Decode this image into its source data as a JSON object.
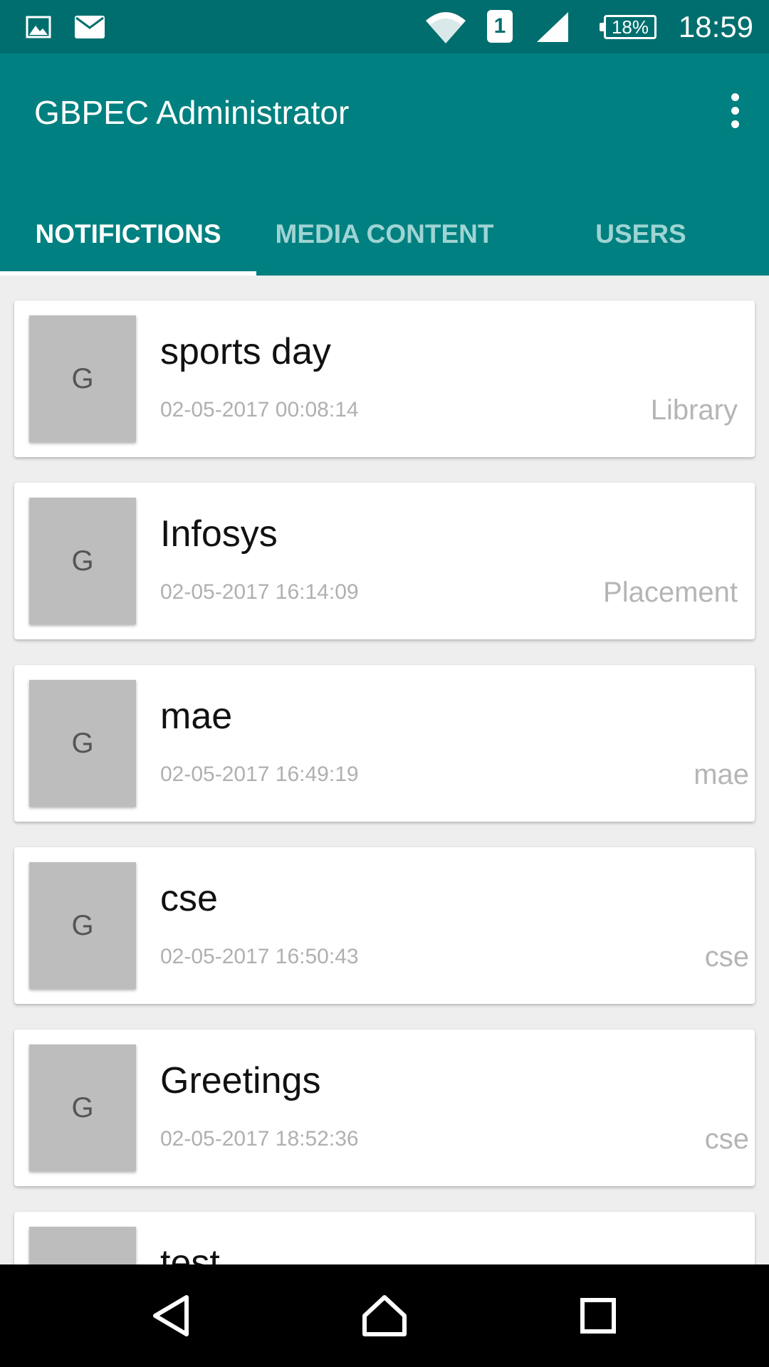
{
  "status_bar": {
    "time": "18:59",
    "battery": "18%",
    "sim_slot": "1",
    "icons": [
      "image-icon",
      "mail-icon",
      "wifi-icon",
      "sim-icon",
      "signal-icon",
      "battery-icon"
    ]
  },
  "app_bar": {
    "title": "GBPEC Administrator",
    "overflow_icon": "more-vert-icon"
  },
  "tabs": [
    {
      "label": "NOTIFICTIONS",
      "selected": true
    },
    {
      "label": "MEDIA CONTENT",
      "selected": false
    },
    {
      "label": "USERS",
      "selected": false
    }
  ],
  "colors": {
    "primary": "#008080",
    "primary_dark": "#006e6e",
    "tab_inactive": "#9fd4d4",
    "background": "#eeeeee"
  },
  "notifications": [
    {
      "avatar": "G",
      "title": "sports day",
      "timestamp": "02-05-2017 00:08:14",
      "tag": "Library"
    },
    {
      "avatar": "G",
      "title": "Infosys",
      "timestamp": "02-05-2017 16:14:09",
      "tag": "Placement"
    },
    {
      "avatar": "G",
      "title": "mae",
      "timestamp": "02-05-2017 16:49:19",
      "tag": "mae"
    },
    {
      "avatar": "G",
      "title": "cse",
      "timestamp": "02-05-2017 16:50:43",
      "tag": "cse"
    },
    {
      "avatar": "G",
      "title": "Greetings",
      "timestamp": "02-05-2017 18:52:36",
      "tag": "cse"
    },
    {
      "avatar": "",
      "title": "test",
      "timestamp": "",
      "tag": ""
    }
  ],
  "nav_bar": {
    "icons": [
      "back-icon",
      "home-icon",
      "recents-icon"
    ]
  }
}
